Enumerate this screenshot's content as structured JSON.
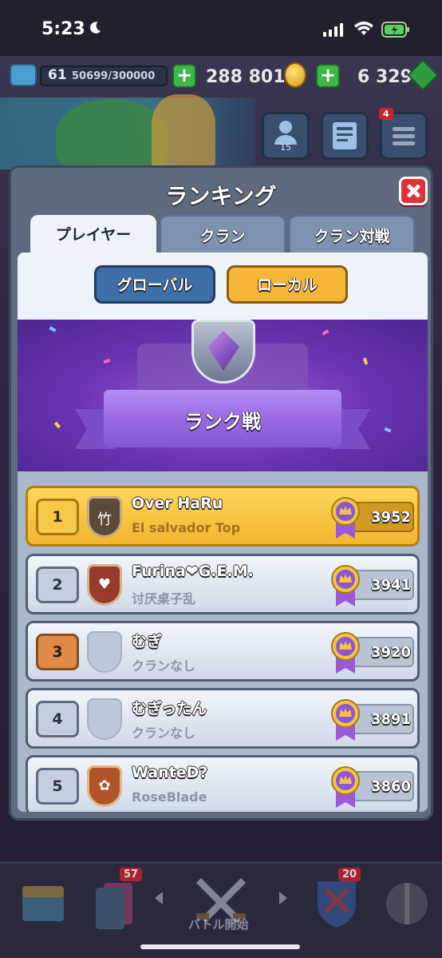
{
  "status_bar": {
    "time": "5:23"
  },
  "top_bar": {
    "level": "61",
    "xp": "50699/300000",
    "gold": "288 801",
    "gems": "6 329",
    "friends_count": "15",
    "menu_badge": "4"
  },
  "modal": {
    "title": "ランキング",
    "tabs": [
      {
        "label": "プレイヤー",
        "active": true
      },
      {
        "label": "クラン",
        "active": false
      },
      {
        "label": "クラン対戦",
        "active": false
      }
    ],
    "scope_buttons": {
      "global": "グローバル",
      "local": "ローカル"
    },
    "banner_title": "ランク戦"
  },
  "leaderboard": [
    {
      "rank": "1",
      "name": "Over HaRu",
      "clan": "El salvador Top",
      "trophies": "3952",
      "style": "gold",
      "badge": "bamboo"
    },
    {
      "rank": "2",
      "name": "Furina❤G.E.M.",
      "clan": "讨厌桌子乱",
      "trophies": "3941",
      "style": "silver",
      "badge": "heart"
    },
    {
      "rank": "3",
      "name": "むぎ",
      "clan": "クランなし",
      "trophies": "3920",
      "style": "bronze",
      "badge": "empty"
    },
    {
      "rank": "4",
      "name": "むぎったん",
      "clan": "クランなし",
      "trophies": "3891",
      "style": "silver",
      "badge": "empty"
    },
    {
      "rank": "5",
      "name": "WanteD?",
      "clan": "RoseBlade",
      "trophies": "3860",
      "style": "silver",
      "badge": "flower"
    }
  ],
  "bottom_nav": {
    "cards_badge": "57",
    "battle_label": "バトル開始",
    "clan_badge": "20"
  }
}
